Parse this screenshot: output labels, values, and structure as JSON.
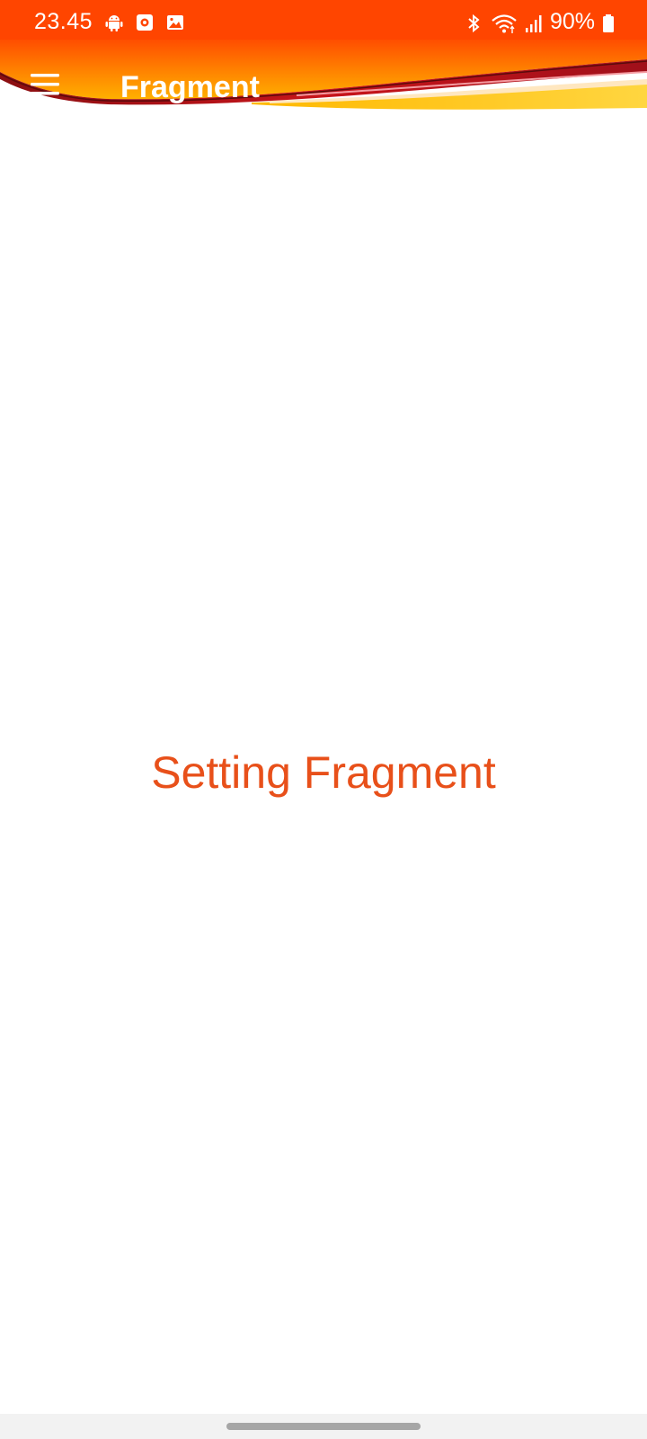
{
  "status_bar": {
    "time": "23.45",
    "battery": "90%",
    "left_icons": [
      "android-icon",
      "record-icon",
      "gallery-icon"
    ],
    "right_icons": [
      "bluetooth-icon",
      "wifi-icon",
      "signal-icon",
      "battery-icon"
    ]
  },
  "toolbar": {
    "title": "Fragment",
    "menu_icon": "hamburger-menu-icon"
  },
  "content": {
    "message": "Setting Fragment"
  },
  "colors": {
    "accent": "#ff4500",
    "text_accent": "#e8501a",
    "wave_red": "#b8141a",
    "wave_yellow": "#ffc400"
  }
}
